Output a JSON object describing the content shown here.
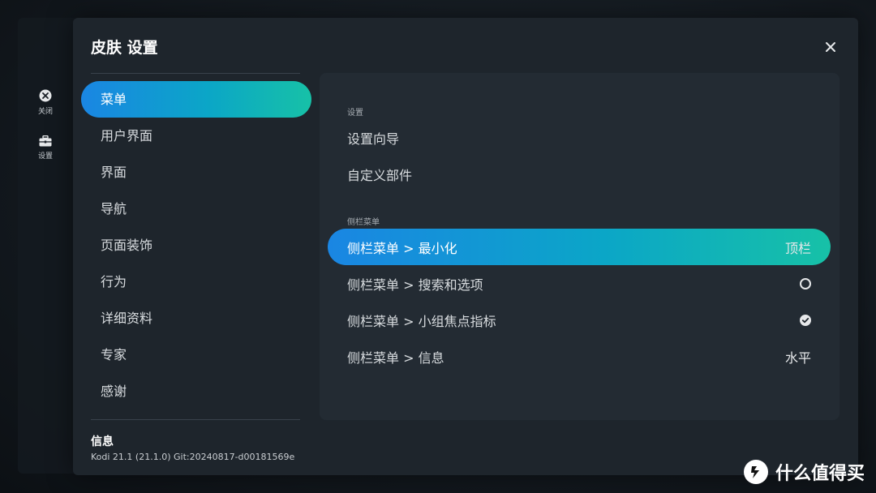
{
  "mini_sidebar": {
    "items": [
      {
        "label": "关闭",
        "icon": "close-circle-icon"
      },
      {
        "label": "设置",
        "icon": "toolbox-icon"
      }
    ]
  },
  "dialog": {
    "title": "皮肤 设置",
    "close_icon": "close-icon"
  },
  "categories": [
    {
      "label": "菜单",
      "active": true
    },
    {
      "label": "用户界面"
    },
    {
      "label": "界面"
    },
    {
      "label": "导航"
    },
    {
      "label": "页面装饰"
    },
    {
      "label": "行为"
    },
    {
      "label": "详细资料"
    },
    {
      "label": "专家"
    },
    {
      "label": "感谢"
    }
  ],
  "info": {
    "title": "信息",
    "version": "Kodi 21.1 (21.1.0) Git:20240817-d00181569e"
  },
  "panel": {
    "sections": [
      {
        "label": "设置",
        "rows": [
          {
            "label": "设置向导"
          },
          {
            "label": "自定义部件"
          }
        ]
      },
      {
        "label": "侧栏菜单",
        "rows": [
          {
            "label": "侧栏菜单 > 最小化",
            "value": "顶栏",
            "active": true
          },
          {
            "label": "侧栏菜单 > 搜索和选项",
            "control": "radio-off"
          },
          {
            "label": "侧栏菜单 > 小组焦点指标",
            "control": "check-on"
          },
          {
            "label": "侧栏菜单 > 信息",
            "value": "水平"
          }
        ]
      }
    ]
  },
  "watermark": {
    "text": "什么值得买",
    "icon": "smzdm-logo-icon"
  },
  "colors": {
    "accent_start": "#1a86e3",
    "accent_end": "#17c1a7",
    "dialog_bg": "#1e252c",
    "panel_bg": "#232b33"
  }
}
